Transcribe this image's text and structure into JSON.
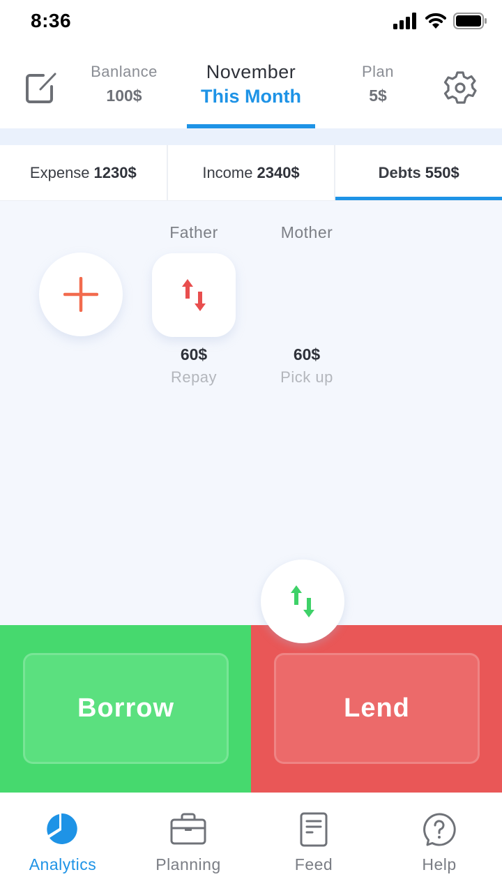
{
  "status_bar": {
    "time": "8:36",
    "icons": [
      "signal-icon",
      "wifi-icon",
      "battery-icon"
    ]
  },
  "header": {
    "balance": {
      "label": "Banlance",
      "value": "100$"
    },
    "month": {
      "name": "November",
      "period": "This Month"
    },
    "plan": {
      "label": "Plan",
      "value": "5$"
    },
    "icons": {
      "left": "edit-icon",
      "right": "gear-icon"
    }
  },
  "tabs": [
    {
      "label": "Expense",
      "value": "1230$",
      "active": false
    },
    {
      "label": "Income",
      "value": "2340$",
      "active": false
    },
    {
      "label": "Debts",
      "value": "550$",
      "active": true
    }
  ],
  "debts": {
    "add_icon": "plus-icon",
    "people": [
      {
        "name": "Father",
        "amount": "60$",
        "action": "Repay",
        "icon": "swap-arrows-icon"
      },
      {
        "name": "Mother",
        "amount": "60$",
        "action": "Pick up"
      }
    ]
  },
  "actions": {
    "borrow": "Borrow",
    "lend": "Lend",
    "swap_icon": "swap-arrows-icon"
  },
  "bottom_nav": [
    {
      "label": "Analytics",
      "icon": "pie-chart-icon",
      "active": true
    },
    {
      "label": "Planning",
      "icon": "briefcase-icon",
      "active": false
    },
    {
      "label": "Feed",
      "icon": "document-icon",
      "active": false
    },
    {
      "label": "Help",
      "icon": "help-bubble-icon",
      "active": false
    }
  ],
  "colors": {
    "accent": "#1e93e6",
    "borrow": "#46d96e",
    "lend": "#e95757",
    "plus": "#f26b4e",
    "arrow_red": "#e84e4e",
    "arrow_green": "#3ed168"
  }
}
